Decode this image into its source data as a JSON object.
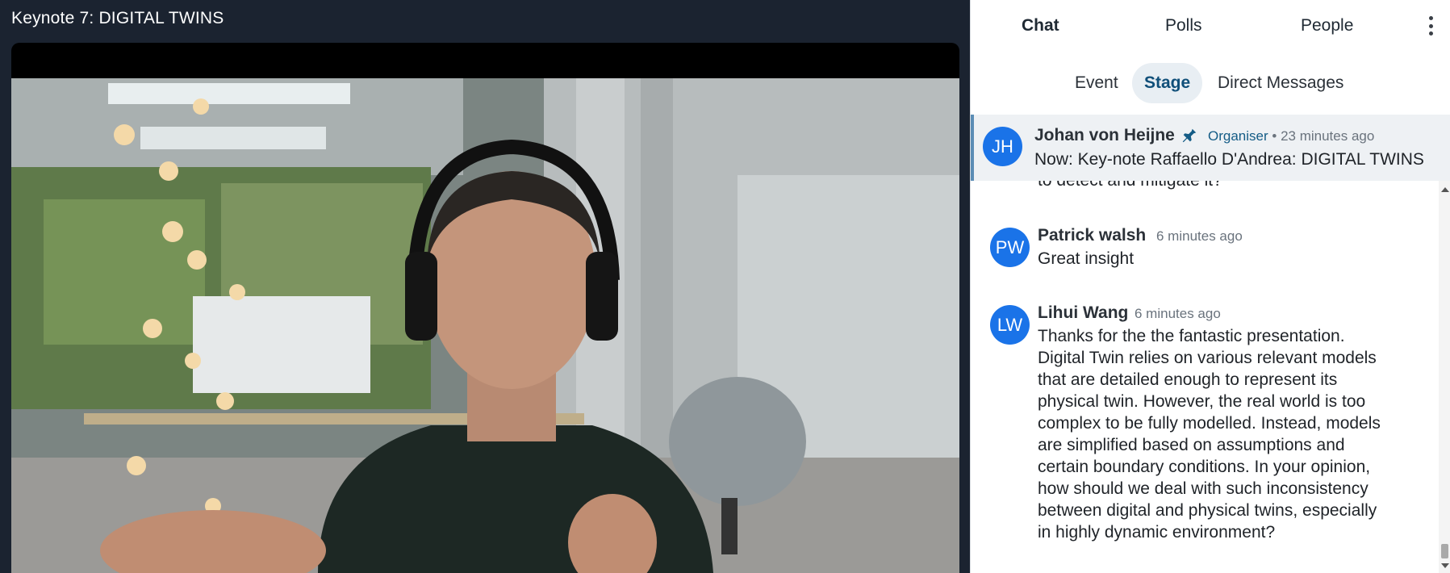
{
  "stage": {
    "title": "Keynote 7: DIGITAL TWINS"
  },
  "tabs": [
    {
      "label": "Chat",
      "active": true
    },
    {
      "label": "Polls",
      "active": false
    },
    {
      "label": "People",
      "active": false
    }
  ],
  "subtabs": [
    {
      "label": "Event",
      "active": false
    },
    {
      "label": "Stage",
      "active": true
    },
    {
      "label": "Direct Messages",
      "active": false
    }
  ],
  "pinned": {
    "initials": "JH",
    "name": "Johan von Heijne",
    "role": "Organiser",
    "separator": "•",
    "time": "23 minutes ago",
    "text": "Now: Key-note Raffaello D'Andrea: DIGITAL TWINS"
  },
  "messages": {
    "clipped_text": "to detect and mitigate it?",
    "items": [
      {
        "initials": "PW",
        "name": "Patrick walsh",
        "time": "6 minutes ago",
        "lines": [
          "Great insight"
        ]
      },
      {
        "initials": "LW",
        "name": "Lihui Wang",
        "time": "6 minutes ago",
        "lines": [
          "Thanks for the the fantastic presentation.",
          "Digital Twin relies on various relevant models",
          "that are detailed enough to represent its",
          "physical twin. However, the real world is too",
          "complex to be fully modelled. Instead, models",
          "are simplified based on assumptions and",
          "certain boundary conditions. In your opinion,",
          "how should we deal with such inconsistency",
          "between digital and physical twins, especially",
          "in highly dynamic environment?"
        ]
      }
    ]
  },
  "colors": {
    "stage_bg": "#1b2330",
    "avatar_blue": "#1a73e8",
    "organiser": "#145c86",
    "pinned_bg": "#eef1f4"
  },
  "icons": {
    "pin": "pin-icon",
    "more": "more-vertical-icon"
  }
}
